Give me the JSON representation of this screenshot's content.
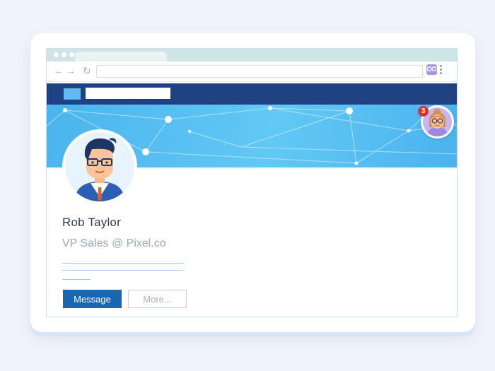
{
  "profile": {
    "name": "Rob Taylor",
    "title": "VP Sales @ Pixel.co"
  },
  "actions": {
    "message_label": "Message",
    "more_label": "More..."
  },
  "notifications": {
    "count": "3"
  },
  "icons": {
    "back": "arrow-left-icon",
    "forward": "arrow-right-icon",
    "reload": "reload-icon",
    "extension": "extension-glasses-icon",
    "menu": "kebab-menu-icon"
  },
  "colors": {
    "nav_bar": "#1f4282",
    "cover": "#4bb4ee",
    "primary_button": "#1a66b0",
    "badge": "#e0302c"
  }
}
